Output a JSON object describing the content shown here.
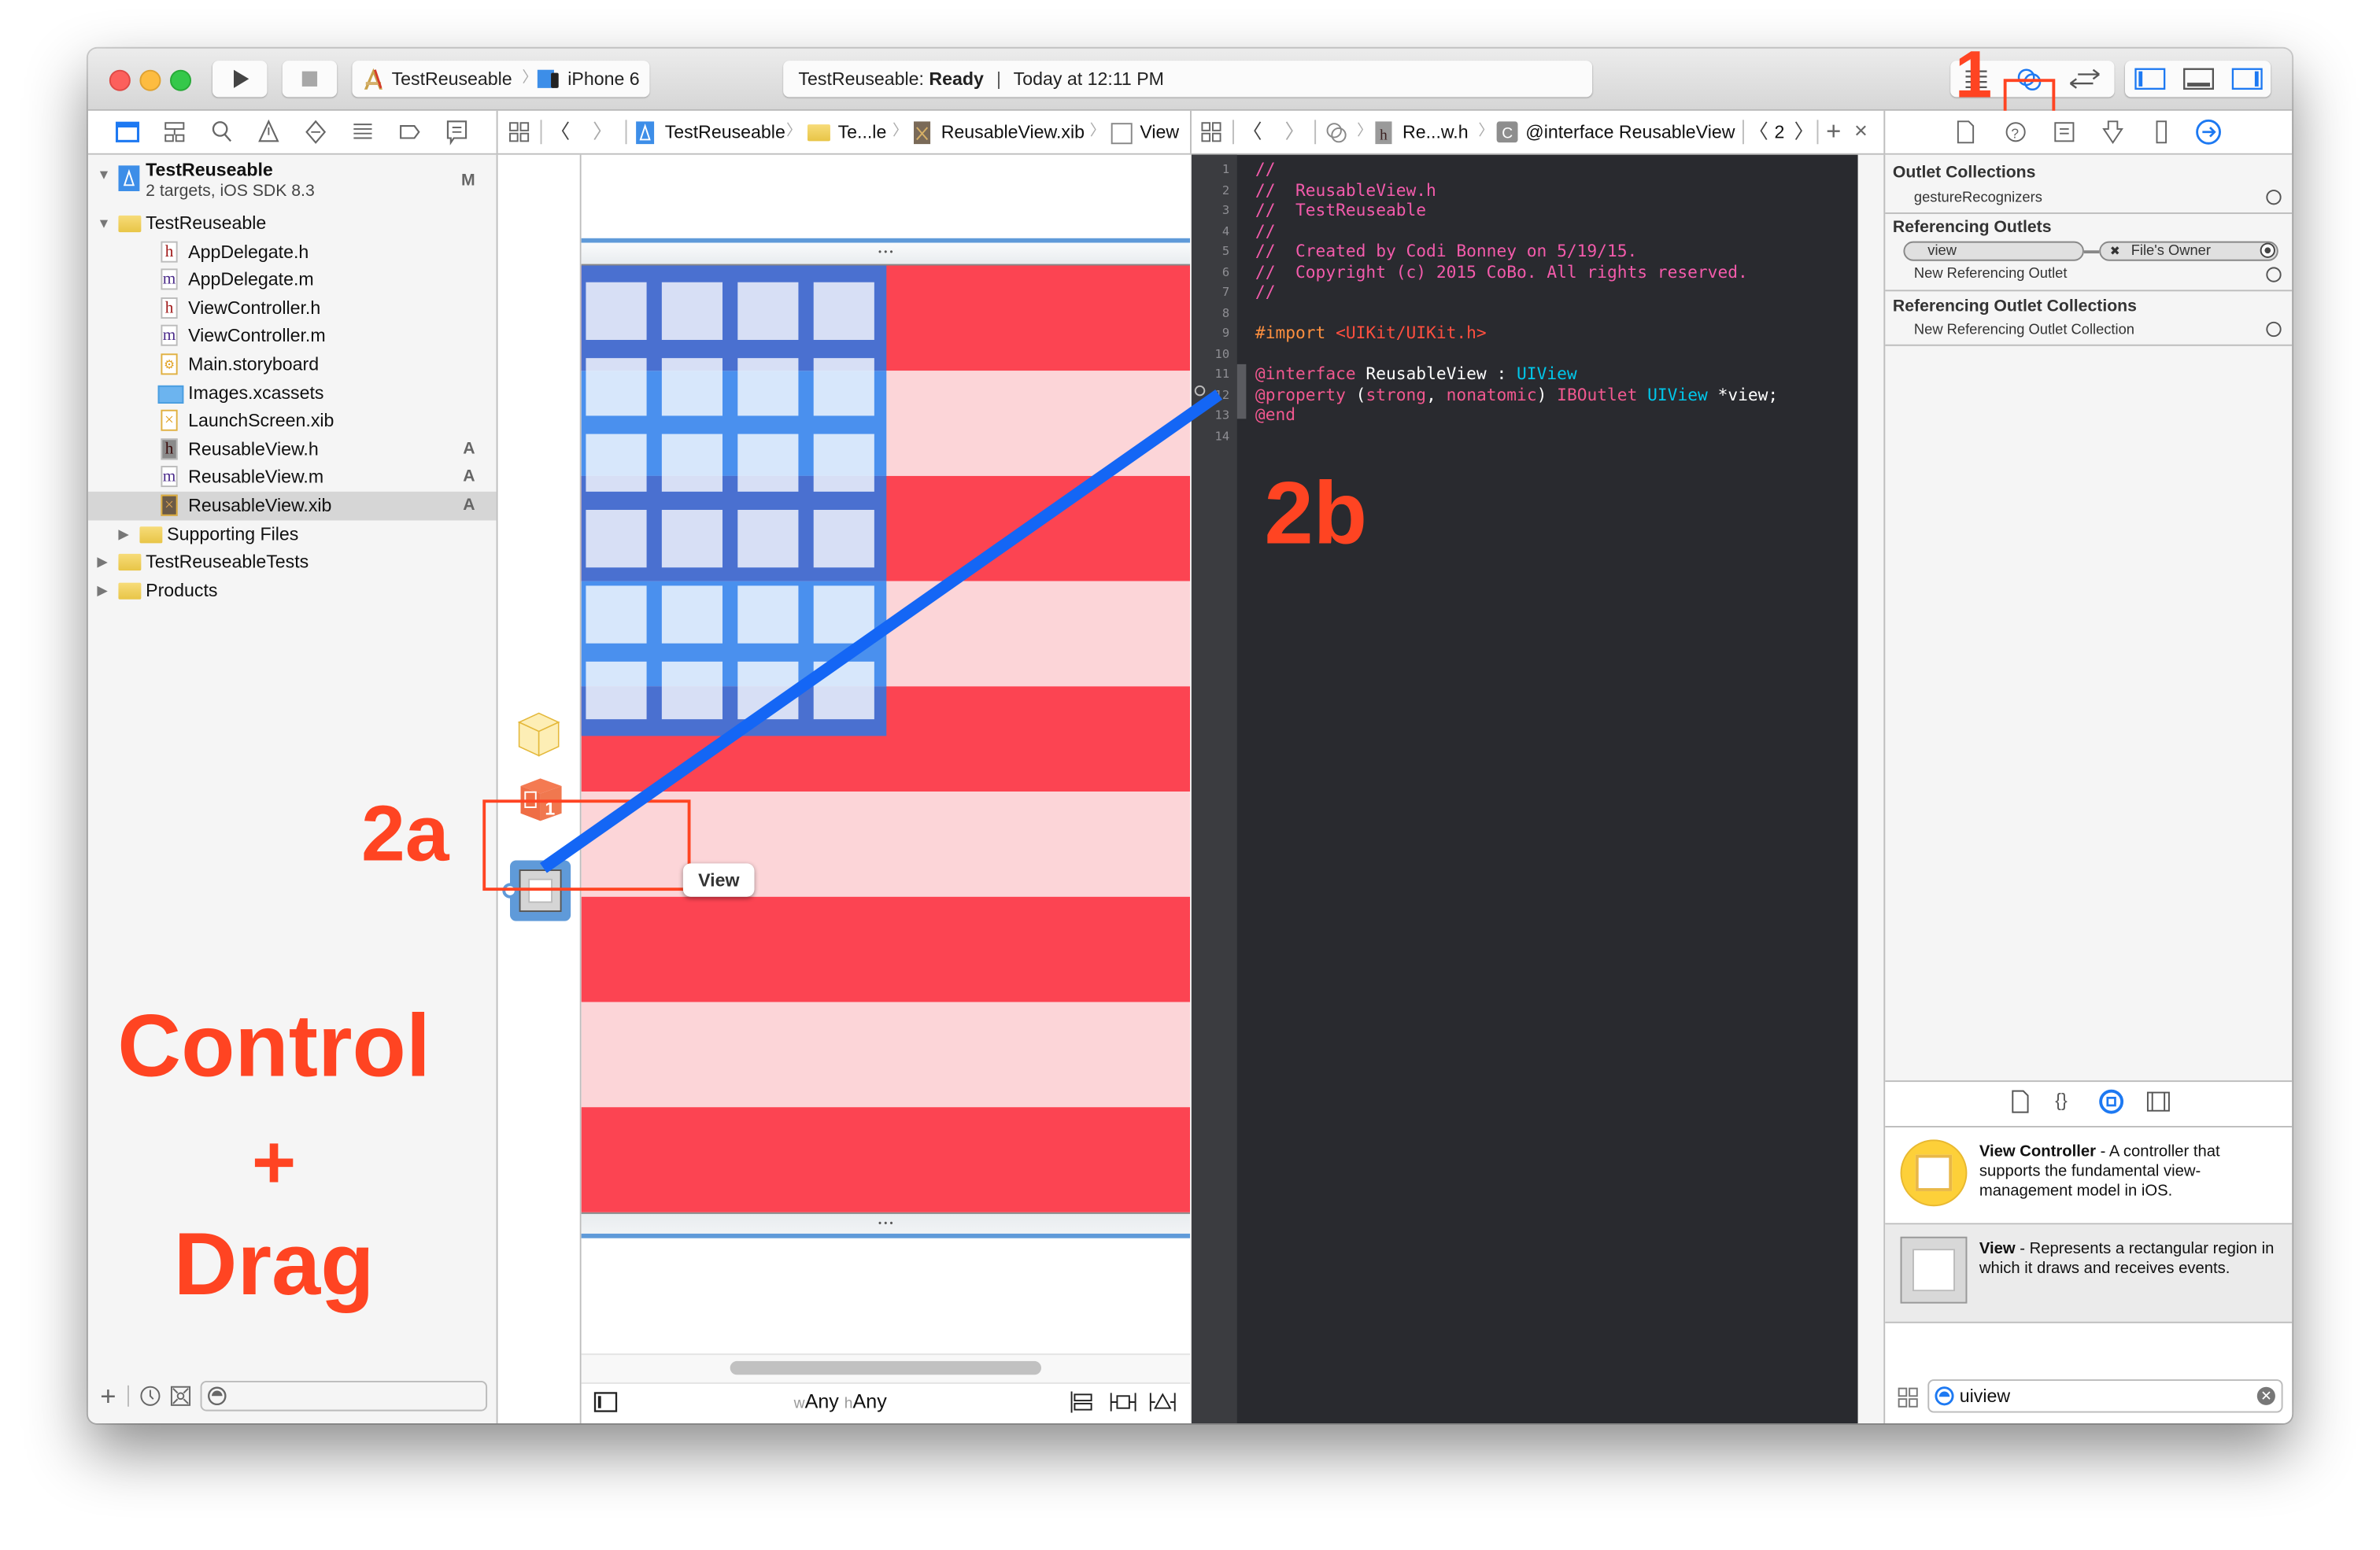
{
  "toolbar": {
    "scheme": "TestReuseable",
    "device": "iPhone 6",
    "status_project": "TestReuseable:",
    "status_state": "Ready",
    "status_time": "Today at 12:11 PM",
    "icons": [
      "run-icon",
      "stop-icon",
      "standard-editor-icon",
      "assistant-editor-icon",
      "version-editor-icon",
      "navigator-toggle-icon",
      "debug-area-toggle-icon",
      "utilities-toggle-icon"
    ]
  },
  "navigator_tabs": [
    "project-navigator",
    "symbol-navigator",
    "find-navigator",
    "issue-navigator",
    "test-navigator",
    "debug-navigator",
    "breakpoint-navigator",
    "report-navigator"
  ],
  "editor_jumpbar": {
    "crumbs": [
      "TestReuseable",
      "Te...le",
      "ReusableView.xib",
      "View"
    ]
  },
  "assistant_jumpbar": {
    "crumbs": [
      "Re...w.h",
      "@interface ReusableView"
    ],
    "counter": "2"
  },
  "project": {
    "name": "TestReuseable",
    "subtitle": "2 targets, iOS SDK 8.3",
    "badge": "M",
    "items": [
      {
        "label": "TestReuseable",
        "type": "folder",
        "depth": 1,
        "expanded": true,
        "badge": ""
      },
      {
        "label": "AppDelegate.h",
        "type": "h",
        "depth": 2,
        "badge": ""
      },
      {
        "label": "AppDelegate.m",
        "type": "m",
        "depth": 2,
        "badge": ""
      },
      {
        "label": "ViewController.h",
        "type": "h",
        "depth": 2,
        "badge": ""
      },
      {
        "label": "ViewController.m",
        "type": "m",
        "depth": 2,
        "badge": ""
      },
      {
        "label": "Main.storyboard",
        "type": "storyboard",
        "depth": 2,
        "badge": ""
      },
      {
        "label": "Images.xcassets",
        "type": "xcassets",
        "depth": 2,
        "badge": ""
      },
      {
        "label": "LaunchScreen.xib",
        "type": "xib",
        "depth": 2,
        "badge": ""
      },
      {
        "label": "ReusableView.h",
        "type": "h",
        "depth": 2,
        "badge": "A"
      },
      {
        "label": "ReusableView.m",
        "type": "m",
        "depth": 2,
        "badge": "A"
      },
      {
        "label": "ReusableView.xib",
        "type": "xib",
        "depth": 2,
        "badge": "A",
        "selected": true
      },
      {
        "label": "Supporting Files",
        "type": "folder",
        "depth": 2,
        "expanded": false,
        "badge": ""
      },
      {
        "label": "TestReuseableTests",
        "type": "folder",
        "depth": 1,
        "expanded": false,
        "badge": ""
      },
      {
        "label": "Products",
        "type": "folder",
        "depth": 1,
        "expanded": false,
        "badge": ""
      }
    ],
    "filter_placeholder": ""
  },
  "canvas": {
    "view_tooltip": "View",
    "size_class_w_prefix": "w",
    "size_class_w": "Any",
    "size_class_h_prefix": "h",
    "size_class_h": "Any",
    "handle_dots": "• • •"
  },
  "code": {
    "lines": [
      {
        "n": "1",
        "parts": [
          {
            "t": "//",
            "c": "#f35bab"
          }
        ]
      },
      {
        "n": "2",
        "parts": [
          {
            "t": "//  ReusableView.h",
            "c": "#f35bab"
          }
        ]
      },
      {
        "n": "3",
        "parts": [
          {
            "t": "//  TestReuseable",
            "c": "#f35bab"
          }
        ]
      },
      {
        "n": "4",
        "parts": [
          {
            "t": "//",
            "c": "#f35bab"
          }
        ]
      },
      {
        "n": "5",
        "parts": [
          {
            "t": "//  Created by Codi Bonney on 5/19/15.",
            "c": "#f35bab"
          }
        ]
      },
      {
        "n": "6",
        "parts": [
          {
            "t": "//  Copyright (c) 2015 CoBo. All rights reserved.",
            "c": "#f35bab"
          }
        ]
      },
      {
        "n": "7",
        "parts": [
          {
            "t": "//",
            "c": "#f35bab"
          }
        ]
      },
      {
        "n": "8",
        "parts": []
      },
      {
        "n": "9",
        "parts": [
          {
            "t": "#import ",
            "c": "#fd8f3f"
          },
          {
            "t": "<UIKit/UIKit.h>",
            "c": "#ff4f3f"
          }
        ]
      },
      {
        "n": "10",
        "parts": []
      },
      {
        "n": "11",
        "parts": [
          {
            "t": "@interface",
            "c": "#f1588f"
          },
          {
            "t": " ReusableView : ",
            "c": "#ffffff"
          },
          {
            "t": "UIView",
            "c": "#00c7ea"
          }
        ]
      },
      {
        "n": "12",
        "parts": [
          {
            "t": "@property",
            "c": "#f1588f"
          },
          {
            "t": " (",
            "c": "#ffffff"
          },
          {
            "t": "strong",
            "c": "#f1588f"
          },
          {
            "t": ", ",
            "c": "#ffffff"
          },
          {
            "t": "nonatomic",
            "c": "#f1588f"
          },
          {
            "t": ") ",
            "c": "#ffffff"
          },
          {
            "t": "IBOutlet",
            "c": "#f1588f"
          },
          {
            "t": " ",
            "c": "#ffffff"
          },
          {
            "t": "UIView",
            "c": "#00c7ea"
          },
          {
            "t": " *view;",
            "c": "#ffffff"
          }
        ]
      },
      {
        "n": "13",
        "parts": [
          {
            "t": "@end",
            "c": "#f1588f"
          }
        ]
      },
      {
        "n": "14",
        "parts": []
      }
    ]
  },
  "inspector": {
    "outlet_collections_title": "Outlet Collections",
    "outlet_collection_item": "gestureRecognizers",
    "referencing_outlets_title": "Referencing Outlets",
    "connection_outlet": "view",
    "connection_target": "File's Owner",
    "new_referencing_outlet": "New Referencing Outlet",
    "referencing_outlet_collections_title": "Referencing Outlet Collections",
    "new_referencing_outlet_collection": "New Referencing Outlet Collection",
    "library_items": [
      {
        "name": "View Controller",
        "desc": " - A controller that supports the fundamental view-management model in iOS."
      },
      {
        "name": "View",
        "desc": " - Represents a rectangular region in which it draws and receives events."
      }
    ],
    "library_search_value": "uiview"
  },
  "annotations": {
    "step1": "1",
    "step2a": "2a",
    "step2b": "2b",
    "instruction_line1": "Control",
    "instruction_line2": "+",
    "instruction_line3": "Drag",
    "color": "#ff4422"
  },
  "colors": {
    "accent": "#1d79f2",
    "stripe_red": "#fc4452",
    "stripe_pink": "#fcd5d8",
    "canton_dark": "#4a70d0",
    "canton_light": "#4a90ee",
    "drag_line": "#1466f5"
  }
}
